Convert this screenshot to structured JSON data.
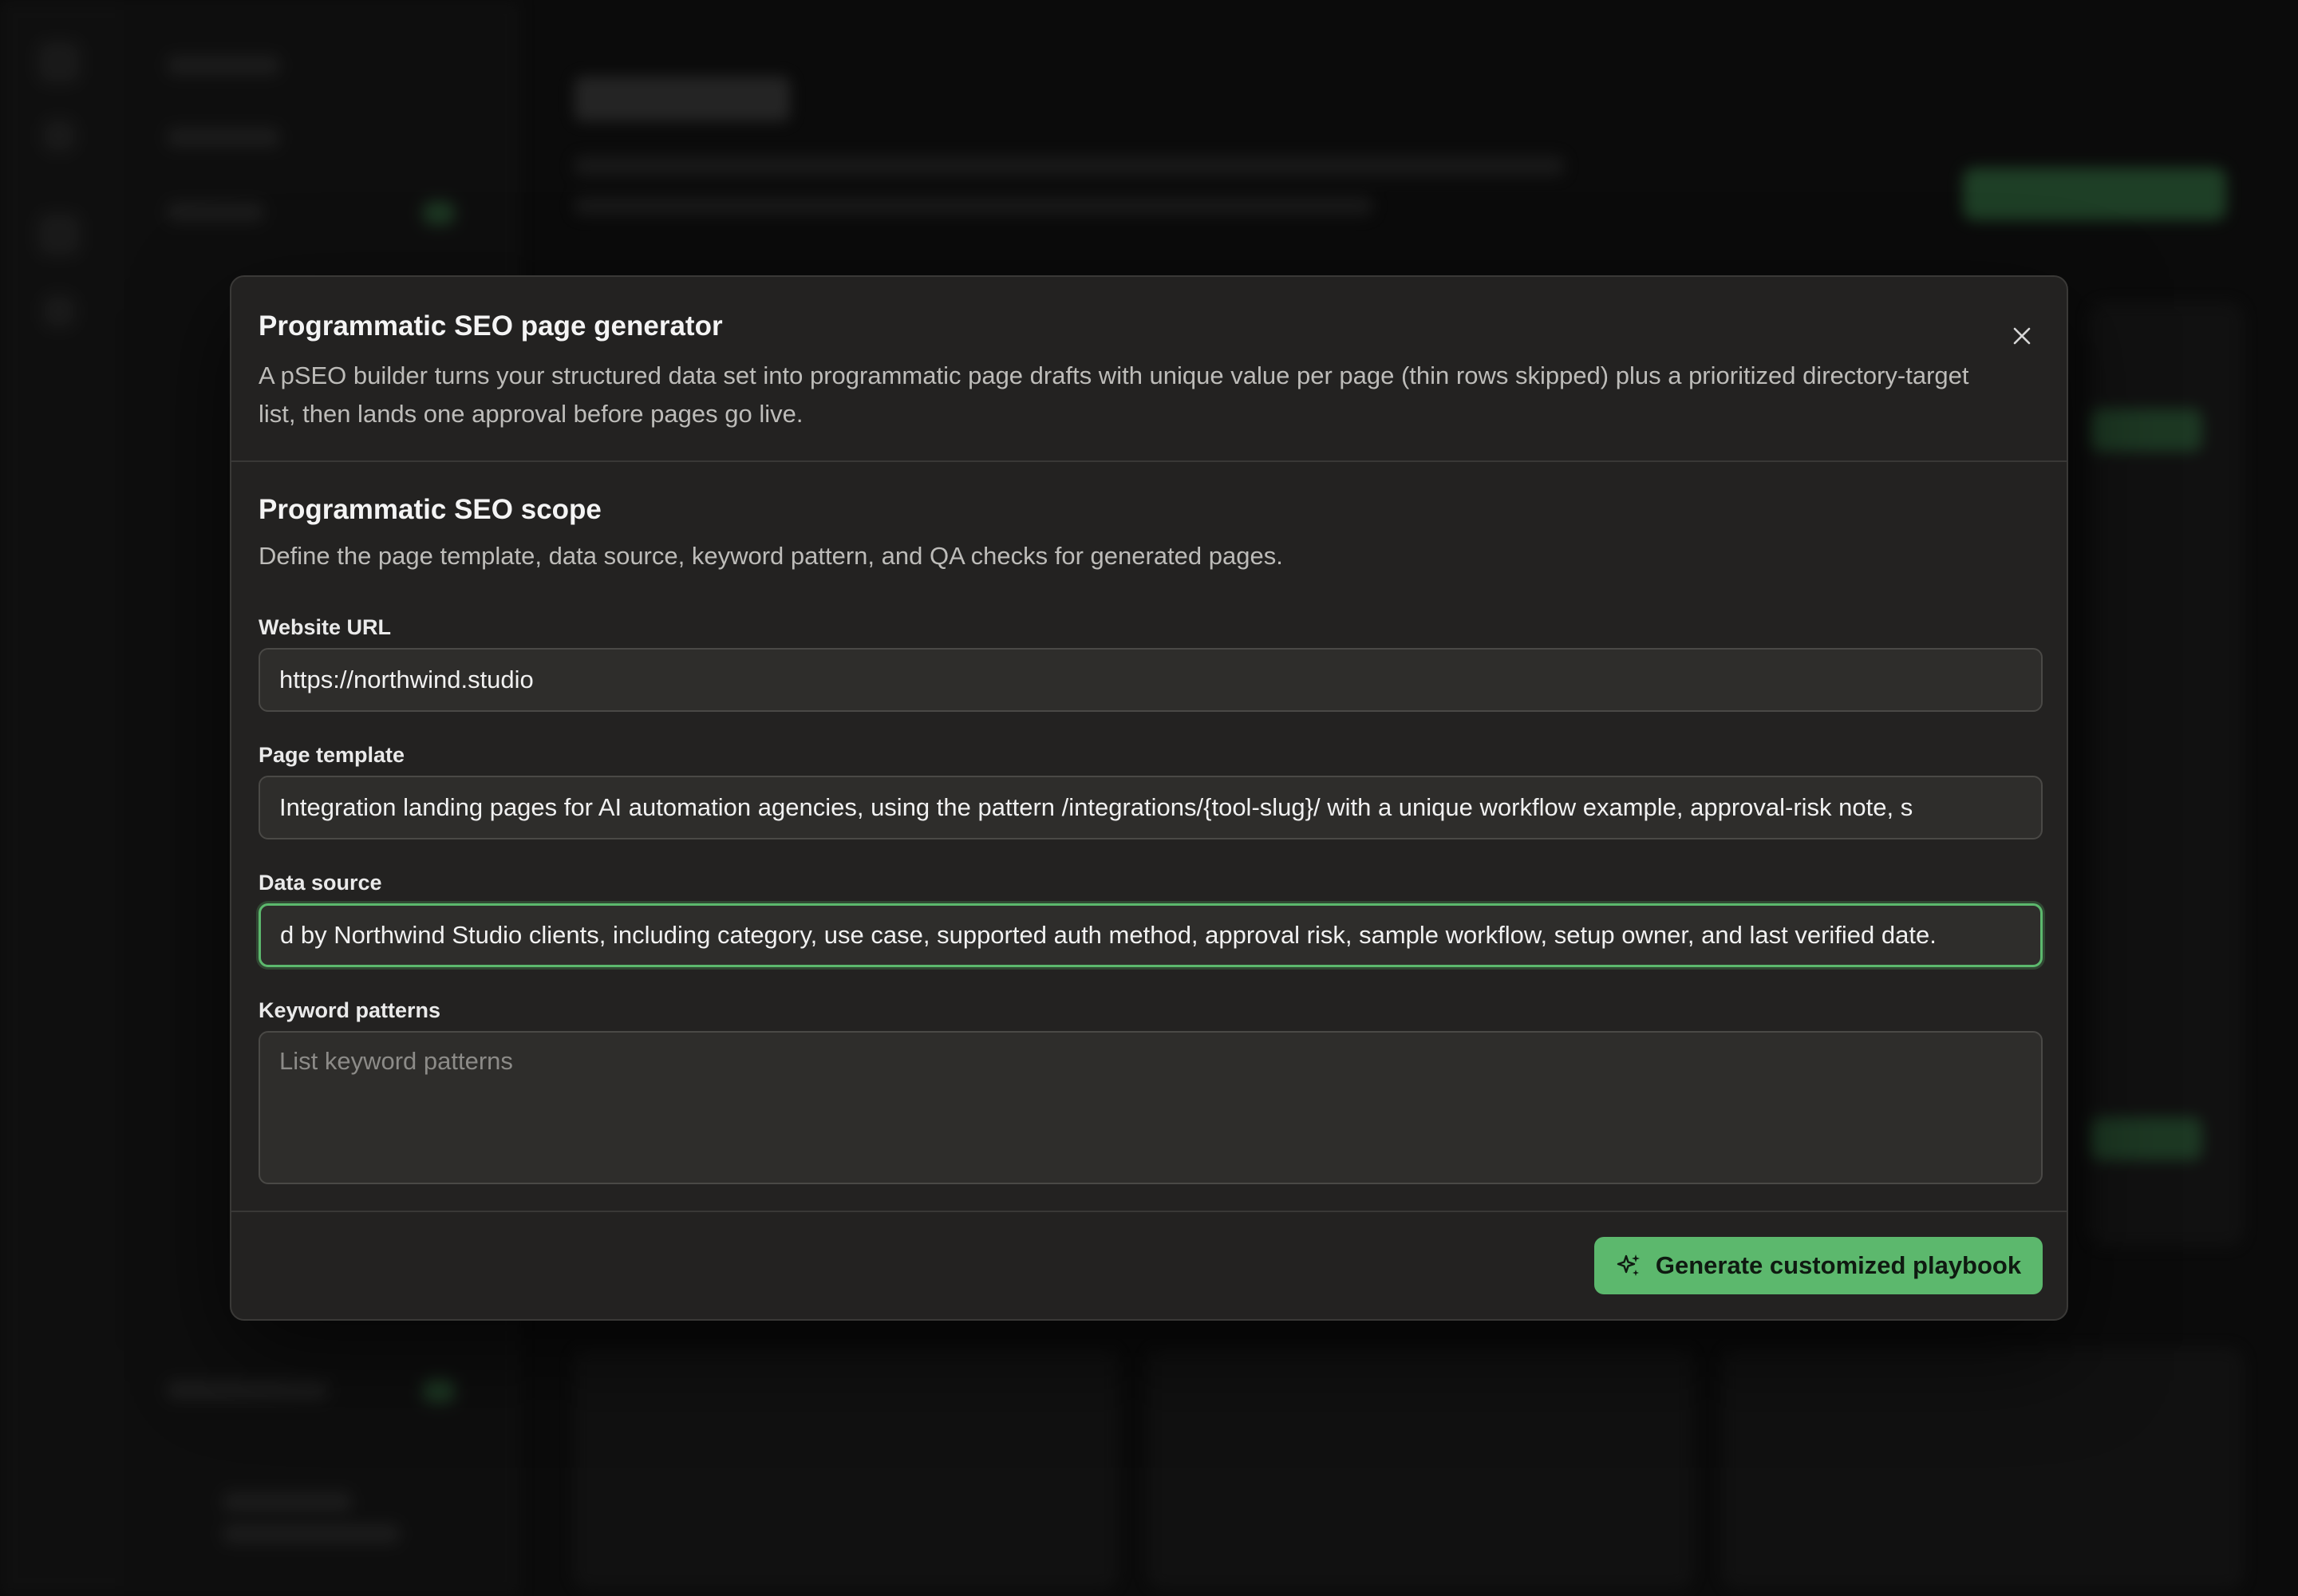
{
  "modal": {
    "title": "Programmatic SEO page generator",
    "description": "A pSEO builder turns your structured data set into programmatic page drafts with unique value per page (thin rows skipped) plus a prioritized directory-target list, then lands one approval before pages go live.",
    "close_icon": "close-icon"
  },
  "scope": {
    "title": "Programmatic SEO scope",
    "description": "Define the page template, data source, keyword pattern, and QA checks for generated pages."
  },
  "fields": {
    "website_url": {
      "label": "Website URL",
      "value": "https://northwind.studio"
    },
    "page_template": {
      "label": "Page template",
      "value": "Integration landing pages for AI automation agencies, using the pattern /integrations/{tool-slug}/ with a unique workflow example, approval-risk note, s"
    },
    "data_source": {
      "label": "Data source",
      "value": "d by Northwind Studio clients, including category, use case, supported auth method, approval risk, sample workflow, setup owner, and last verified date."
    },
    "keyword_patterns": {
      "label": "Keyword patterns",
      "placeholder": "List keyword patterns",
      "value": ""
    }
  },
  "footer": {
    "generate_label": "Generate customized playbook",
    "generate_icon": "sparkles-icon"
  },
  "colors": {
    "accent": "#5cb86d",
    "modal_bg": "#232221",
    "input_bg": "#2e2d2b"
  }
}
